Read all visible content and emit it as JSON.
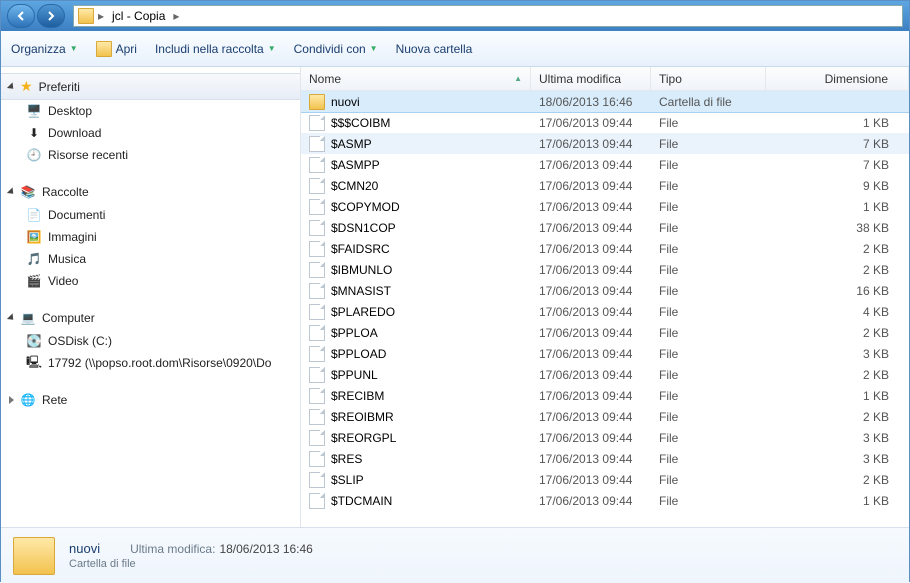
{
  "breadcrumb": [
    "jcl - Copia"
  ],
  "toolbar": {
    "organize": "Organizza",
    "open": "Apri",
    "include": "Includi nella raccolta",
    "share": "Condividi con",
    "newfolder": "Nuova cartella"
  },
  "sidebar": {
    "favorites": {
      "label": "Preferiti",
      "items": [
        {
          "icon": "desktop-icon",
          "label": "Desktop"
        },
        {
          "icon": "download-icon",
          "label": "Download"
        },
        {
          "icon": "recent-icon",
          "label": "Risorse recenti"
        }
      ]
    },
    "libraries": {
      "label": "Raccolte",
      "items": [
        {
          "icon": "documents-icon",
          "label": "Documenti"
        },
        {
          "icon": "pictures-icon",
          "label": "Immagini"
        },
        {
          "icon": "music-icon",
          "label": "Musica"
        },
        {
          "icon": "video-icon",
          "label": "Video"
        }
      ]
    },
    "computer": {
      "label": "Computer",
      "items": [
        {
          "icon": "disk-icon",
          "label": "OSDisk (C:)"
        },
        {
          "icon": "netdrive-icon",
          "label": "17792 (\\\\popso.root.dom\\Risorse\\0920\\Do"
        }
      ]
    },
    "network": {
      "label": "Rete"
    }
  },
  "columns": {
    "name": "Nome",
    "modified": "Ultima modifica",
    "type": "Tipo",
    "size": "Dimensione"
  },
  "files": [
    {
      "name": "nuovi",
      "mod": "18/06/2013 16:46",
      "type": "Cartella di file",
      "size": "",
      "folder": true,
      "sel": true
    },
    {
      "name": "$$$COIBM",
      "mod": "17/06/2013 09:44",
      "type": "File",
      "size": "1 KB"
    },
    {
      "name": "$ASMP",
      "mod": "17/06/2013 09:44",
      "type": "File",
      "size": "7 KB",
      "hint": true
    },
    {
      "name": "$ASMPP",
      "mod": "17/06/2013 09:44",
      "type": "File",
      "size": "7 KB"
    },
    {
      "name": "$CMN20",
      "mod": "17/06/2013 09:44",
      "type": "File",
      "size": "9 KB"
    },
    {
      "name": "$COPYMOD",
      "mod": "17/06/2013 09:44",
      "type": "File",
      "size": "1 KB"
    },
    {
      "name": "$DSN1COP",
      "mod": "17/06/2013 09:44",
      "type": "File",
      "size": "38 KB"
    },
    {
      "name": "$FAIDSRC",
      "mod": "17/06/2013 09:44",
      "type": "File",
      "size": "2 KB"
    },
    {
      "name": "$IBMUNLO",
      "mod": "17/06/2013 09:44",
      "type": "File",
      "size": "2 KB"
    },
    {
      "name": "$MNASIST",
      "mod": "17/06/2013 09:44",
      "type": "File",
      "size": "16 KB"
    },
    {
      "name": "$PLAREDO",
      "mod": "17/06/2013 09:44",
      "type": "File",
      "size": "4 KB"
    },
    {
      "name": "$PPLOA",
      "mod": "17/06/2013 09:44",
      "type": "File",
      "size": "2 KB"
    },
    {
      "name": "$PPLOAD",
      "mod": "17/06/2013 09:44",
      "type": "File",
      "size": "3 KB"
    },
    {
      "name": "$PPUNL",
      "mod": "17/06/2013 09:44",
      "type": "File",
      "size": "2 KB"
    },
    {
      "name": "$RECIBM",
      "mod": "17/06/2013 09:44",
      "type": "File",
      "size": "1 KB"
    },
    {
      "name": "$REOIBMR",
      "mod": "17/06/2013 09:44",
      "type": "File",
      "size": "2 KB"
    },
    {
      "name": "$REORGPL",
      "mod": "17/06/2013 09:44",
      "type": "File",
      "size": "3 KB"
    },
    {
      "name": "$RES",
      "mod": "17/06/2013 09:44",
      "type": "File",
      "size": "3 KB"
    },
    {
      "name": "$SLIP",
      "mod": "17/06/2013 09:44",
      "type": "File",
      "size": "2 KB"
    },
    {
      "name": "$TDCMAIN",
      "mod": "17/06/2013 09:44",
      "type": "File",
      "size": "1 KB"
    }
  ],
  "details": {
    "name": "nuovi",
    "type": "Cartella di file",
    "mod_label": "Ultima modifica:",
    "mod_value": "18/06/2013 16:46"
  }
}
